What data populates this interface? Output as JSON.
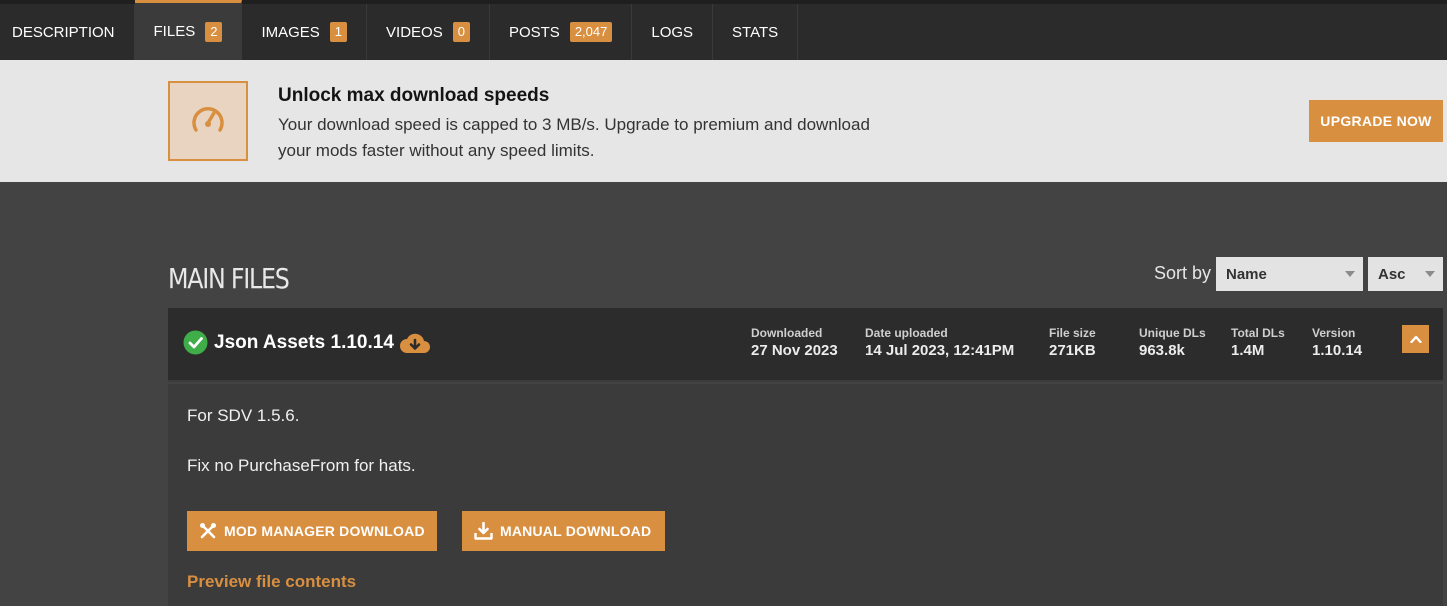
{
  "tabs": [
    {
      "label": "DESCRIPTION",
      "count": null
    },
    {
      "label": "FILES",
      "count": "2"
    },
    {
      "label": "IMAGES",
      "count": "1"
    },
    {
      "label": "VIDEOS",
      "count": "0"
    },
    {
      "label": "POSTS",
      "count": "2,047"
    },
    {
      "label": "LOGS",
      "count": null
    },
    {
      "label": "STATS",
      "count": null
    }
  ],
  "active_tab": "FILES",
  "promo": {
    "title": "Unlock max download speeds",
    "text_line1": "Your download speed is capped to 3 MB/s. Upgrade to premium and download",
    "text_line2": "your mods faster without any speed limits.",
    "button": "UPGRADE NOW",
    "icon": "speedometer-icon"
  },
  "main_files": {
    "title": "MAIN FILES",
    "sort_label": "Sort by",
    "sort_field": "Name",
    "sort_order": "Asc"
  },
  "file": {
    "name": "Json Assets 1.10.14",
    "status_icon": "check-circle-icon",
    "cloud_icon": "cloud-download-icon",
    "stats": {
      "downloaded_label": "Downloaded",
      "downloaded": "27 Nov 2023",
      "uploaded_label": "Date uploaded",
      "uploaded": "14 Jul 2023, 12:41PM",
      "size_label": "File size",
      "size": "271KB",
      "unique_label": "Unique DLs",
      "unique": "963.8k",
      "total_label": "Total DLs",
      "total": "1.4M",
      "version_label": "Version",
      "version": "1.10.14"
    },
    "description": [
      "For SDV 1.5.6.",
      "Fix no PurchaseFrom for hats."
    ],
    "mod_manager_button": "MOD MANAGER DOWNLOAD",
    "manual_button": "MANUAL DOWNLOAD",
    "preview_link": "Preview file contents"
  },
  "colors": {
    "accent": "#d98f40",
    "success": "#3fae49"
  }
}
